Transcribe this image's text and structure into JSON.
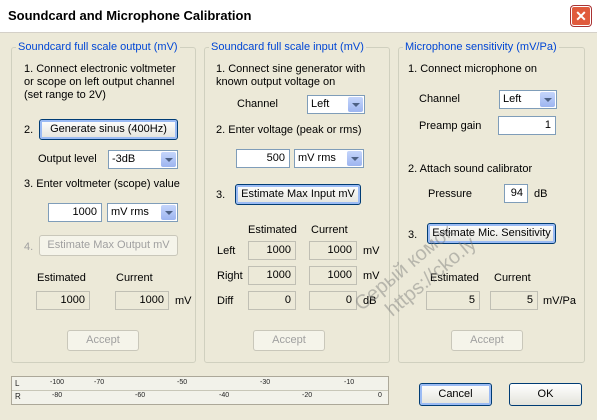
{
  "window": {
    "title": "Soundcard and Microphone Calibration"
  },
  "output": {
    "group_title": "Soundcard full scale output (mV)",
    "step1": "1. Connect electronic voltmeter\nor scope on left output channel\n(set range  to 2V)",
    "step2_num": "2.",
    "generate_label": "Generate sinus (400Hz)",
    "level_label": "Output level",
    "level_value": "-3dB",
    "step3": "3. Enter voltmeter (scope) value",
    "voltage_value": "1000",
    "unit_value": "mV rms",
    "step4_num": "4.",
    "estimate_label": "Estimate Max Output mV",
    "estimated_hdr": "Estimated",
    "current_hdr": "Current",
    "estimated_value": "1000",
    "current_value": "1000",
    "unit": "mV",
    "accept_label": "Accept"
  },
  "input": {
    "group_title": "Soundcard full scale  input (mV)",
    "step1": "1. Connect sine generator with\nknown output voltage on",
    "channel_label": "Channel",
    "channel_value": "Left",
    "step2": "2. Enter voltage (peak or rms)",
    "voltage_value": "500",
    "unit_value": "mV rms",
    "step3_num": "3.",
    "estimate_label": "Estimate Max Input mV",
    "estimated_hdr": "Estimated",
    "current_hdr": "Current",
    "rows": [
      {
        "label": "Left",
        "estimated": "1000",
        "current": "1000",
        "unit": "mV"
      },
      {
        "label": "Right",
        "estimated": "1000",
        "current": "1000",
        "unit": "mV"
      },
      {
        "label": "Diff",
        "estimated": "0",
        "current": "0",
        "unit": "dB"
      }
    ],
    "accept_label": "Accept"
  },
  "mic": {
    "group_title": "Microphone sensitivity (mV/Pa)",
    "step1": "1. Connect microphone on",
    "channel_label": "Channel",
    "channel_value": "Left",
    "gain_label": "Preamp  gain",
    "gain_value": "1",
    "step2": "2. Attach sound calibrator",
    "pressure_label": "Pressure",
    "pressure_value": "94",
    "pressure_unit": "dB",
    "step3_num": "3.",
    "estimate_label": "Estimate Mic. Sensitivity",
    "estimated_hdr": "Estimated",
    "current_hdr": "Current",
    "estimated_value": "5",
    "current_value": "5",
    "unit": "mV/Pa",
    "accept_label": "Accept"
  },
  "meter": {
    "left_label": "L",
    "right_label": "R",
    "left_ticks": [
      "-100",
      "-70",
      "-50",
      "-30",
      "-10"
    ],
    "right_ticks": [
      "-80",
      "-60",
      "-40",
      "-20",
      "0"
    ]
  },
  "footer": {
    "cancel_label": "Cancel",
    "ok_label": "OK"
  },
  "watermark": {
    "line1": "Серый комок",
    "line2": "https://cko.ly"
  }
}
